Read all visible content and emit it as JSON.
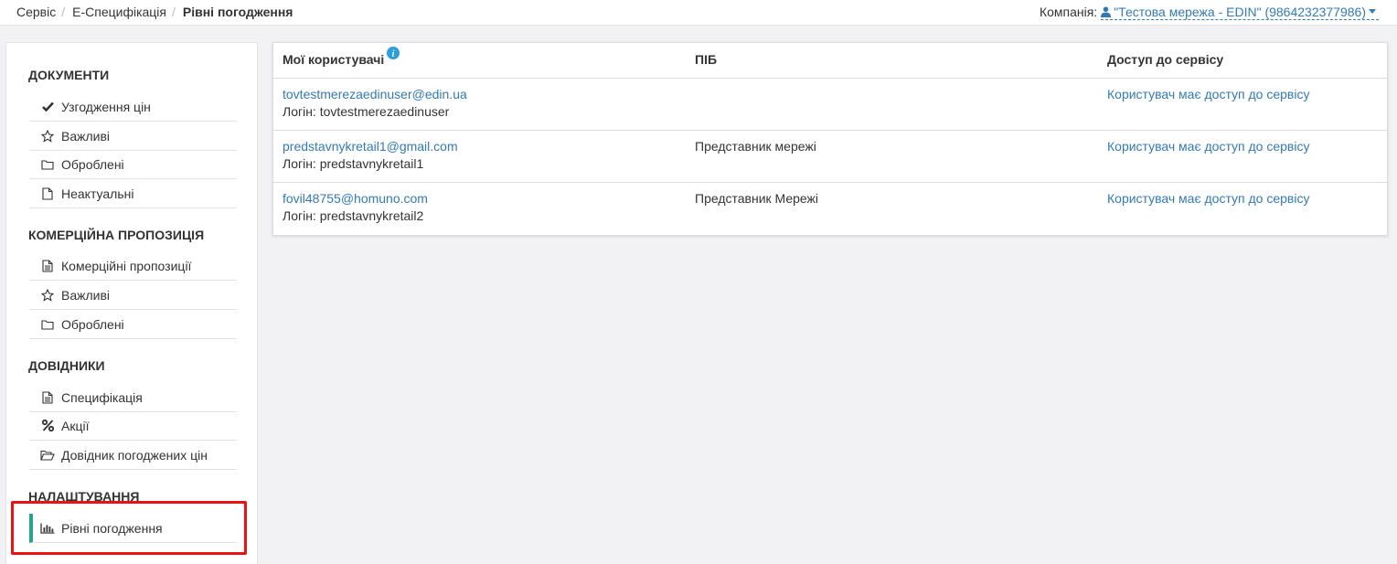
{
  "breadcrumb": {
    "items": [
      "Сервіс",
      "Е-Специфікація"
    ],
    "current": "Рівні погодження"
  },
  "company": {
    "label": "Компанія:",
    "name": "\"Тестова мережа - EDIN\" (9864232377986)"
  },
  "sidebar": {
    "sections": [
      {
        "title": "ДОКУМЕНТИ",
        "items": [
          {
            "label": "Узгодження цін",
            "icon": "check-icon"
          },
          {
            "label": "Важливі",
            "icon": "star-icon"
          },
          {
            "label": "Оброблені",
            "icon": "folder-icon"
          },
          {
            "label": "Неактуальні",
            "icon": "file-icon"
          }
        ]
      },
      {
        "title": "КОМЕРЦІЙНА ПРОПОЗИЦІЯ",
        "items": [
          {
            "label": "Комерційні пропозиції",
            "icon": "file-text-icon"
          },
          {
            "label": "Важливі",
            "icon": "star-icon"
          },
          {
            "label": "Оброблені",
            "icon": "folder-icon"
          }
        ]
      },
      {
        "title": "ДОВІДНИКИ",
        "items": [
          {
            "label": "Специфікація",
            "icon": "file-text-icon"
          },
          {
            "label": "Акції",
            "icon": "percent-icon"
          },
          {
            "label": "Довідник погоджених цін",
            "icon": "folder-open-icon"
          }
        ]
      },
      {
        "title": "НАЛАШТУВАННЯ",
        "items": [
          {
            "label": "Рівні погодження",
            "icon": "bar-chart-icon",
            "active": true
          }
        ]
      }
    ]
  },
  "table": {
    "headers": [
      "Мої користувачі",
      "ПІБ",
      "Доступ до сервісу"
    ],
    "rows": [
      {
        "email": "tovtestmerezaedinuser@edin.ua",
        "login": "Логін: tovtestmerezaedinuser",
        "name": "",
        "access": "Користувач має доступ до сервісу"
      },
      {
        "email": "predstavnykretail1@gmail.com",
        "login": "Логін: predstavnykretail1",
        "name": "Представник мережі",
        "access": "Користувач має доступ до сервісу"
      },
      {
        "email": "fovil48755@homuno.com",
        "login": "Логін: predstavnykretail2",
        "name": "Представник Мережі",
        "access": "Користувач має доступ до сервісу"
      }
    ]
  },
  "colors": {
    "link": "#337ab7",
    "active_accent": "#26a688",
    "highlight": "#ee1111",
    "info": "#2d9fd8"
  }
}
